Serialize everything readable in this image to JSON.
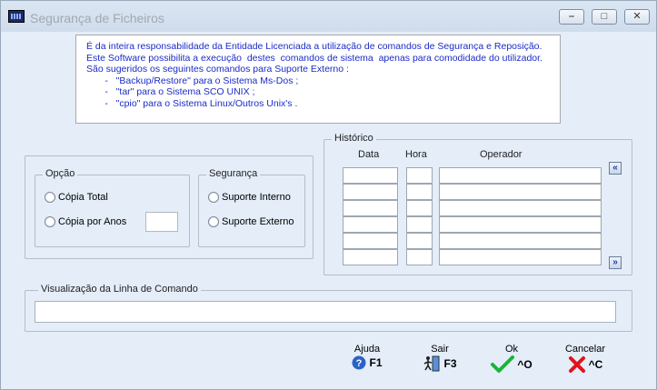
{
  "window": {
    "title": "Segurança de Ficheiros"
  },
  "info": {
    "lines": [
      "É da inteira responsabilidade da Entidade Licenciada a utilização de comandos de Segurança e Reposição.",
      "Este Software possibilita a execução  destes  comandos de sistema  apenas para comodidade do utilizador.",
      "São sugeridos os seguintes comandos para Suporte Externo :",
      "       -   \"Backup/Restore\" para o Sistema Ms-Dos ;",
      "       -   \"tar\" para o Sistema SCO UNIX ;",
      "       -   \"cpio\" para o Sistema Linux/Outros Unix's ."
    ]
  },
  "opcao": {
    "title": "Opção",
    "copia_total": "Cópia Total",
    "copia_por_anos": "Cópia por Anos"
  },
  "seguranca": {
    "title": "Segurança",
    "interno": "Suporte Interno",
    "externo": "Suporte Externo"
  },
  "historico": {
    "title": "Histórico",
    "col_data": "Data",
    "col_hora": "Hora",
    "col_operador": "Operador"
  },
  "command_line": {
    "title": "Visualização da Linha de Comando"
  },
  "actions": {
    "ajuda": {
      "label": "Ajuda",
      "key": "F1"
    },
    "sair": {
      "label": "Sair",
      "key": "F3"
    },
    "ok": {
      "label": "Ok",
      "key": "^O"
    },
    "cancelar": {
      "label": "Cancelar",
      "key": "^C"
    }
  }
}
